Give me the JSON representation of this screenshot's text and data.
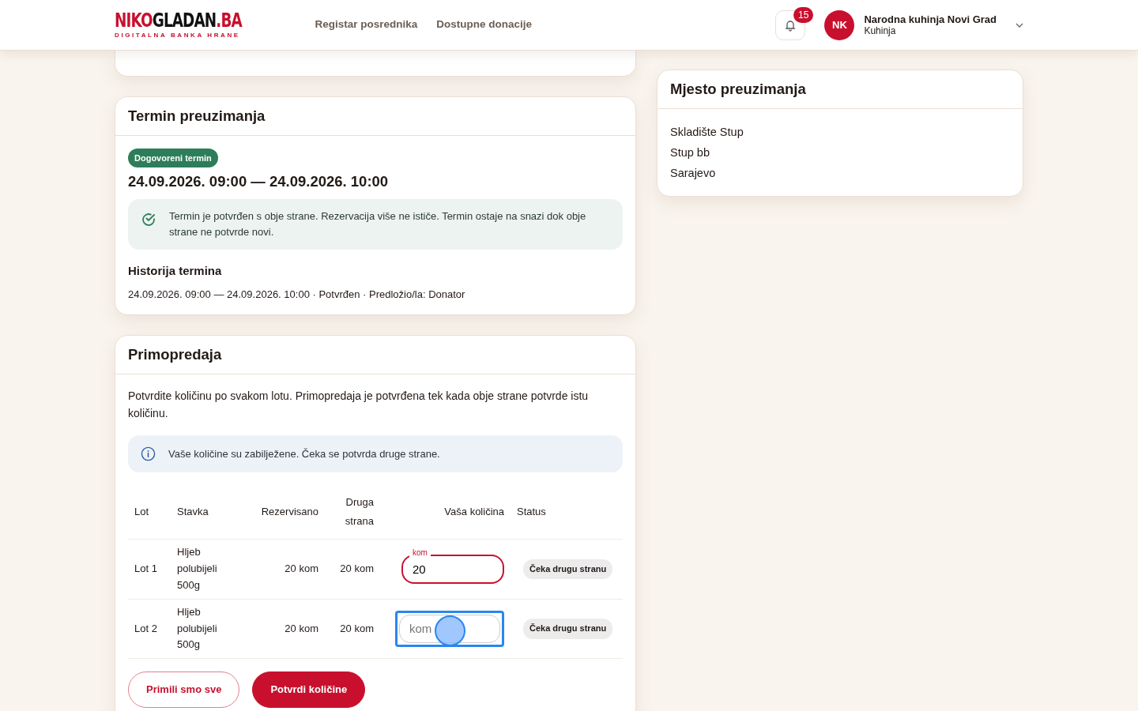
{
  "header": {
    "logo": [
      {
        "text": "NIKO",
        "color": "#c8102e"
      },
      {
        "text": "GLADAN",
        "color": "#111111"
      },
      {
        "text": ".BA",
        "color": "#c8102e"
      }
    ],
    "tagline": "DIGITALNA BANKA HRANE",
    "nav_links": [
      "Registar posrednika",
      "Dostupne donacije"
    ],
    "notifications": {
      "count": "15"
    },
    "user": {
      "initials": "NK",
      "name": "Narodna kuhinja Novi Grad",
      "role": "Kuhinja"
    }
  },
  "schedule": {
    "title": "Termin preuzimanja",
    "badge": "Dogovoreni termin",
    "range": "24.09.2026. 09:00 — 24.09.2026. 10:00",
    "alert": "Termin je potvrđen s obje strane. Rezervacija više ne ističe. Termin ostaje na snazi dok obje strane ne potvrde novi.",
    "history_title": "Historija termina",
    "history": [
      "24.09.2026. 09:00 — 24.09.2026. 10:00 · Potvrđen · Predložio/la: Donator"
    ]
  },
  "handover": {
    "title": "Primopredaja",
    "intro": "Potvrdite količinu po svakom lotu. Primopredaja je potvrđena tek kada obje strane potvrde istu količinu.",
    "alert": "Vaše količine su zabilježene. Čeka se potvrda druge strane.",
    "columns": [
      "Lot",
      "Stavka",
      "Rezervisano",
      "Druga strana",
      "Vaša količina",
      "Status"
    ],
    "rows": [
      {
        "lot": "Lot 1",
        "item": "Hljeb polubijeli 500g",
        "reserved": "20 kom",
        "other": "20 kom",
        "input": {
          "label": "kom",
          "value": "20",
          "focused": false
        },
        "status": "Čeka drugu stranu"
      },
      {
        "lot": "Lot 2",
        "item": "Hljeb polubijeli 500g",
        "reserved": "20 kom",
        "other": "20 kom",
        "input": {
          "placeholder": "kom",
          "focused": true
        },
        "status": "Čeka drugu stranu"
      }
    ],
    "buttons": [
      {
        "label": "Primili smo sve",
        "kind": "outline"
      },
      {
        "label": "Potvrdi količine",
        "kind": "primary"
      }
    ]
  },
  "pickup": {
    "title": "Mjesto preuzimanja",
    "lines": [
      "Skladište Stup",
      "Stup bb",
      "Sarajevo"
    ]
  }
}
